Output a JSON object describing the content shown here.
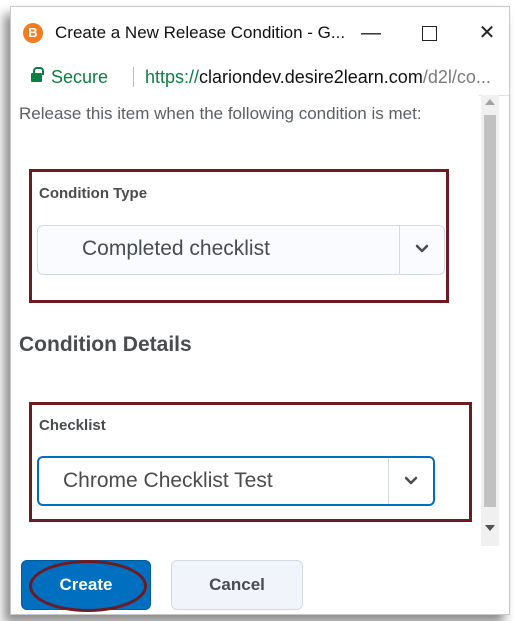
{
  "window": {
    "title": "Create a New Release Condition - G...",
    "favicon_glyph": "B",
    "controls": {
      "minimize": "—",
      "close": "✕"
    }
  },
  "addressbar": {
    "secure_label": "Secure",
    "url_scheme": "https://",
    "url_host": "clariondev.desire2learn.com",
    "url_path": "/d2l/co..."
  },
  "dialog": {
    "intro": "Release this item when the following condition is met:",
    "condition_type": {
      "label": "Condition Type",
      "selected": "Completed checklist"
    },
    "details_heading": "Condition Details",
    "checklist": {
      "label": "Checklist",
      "selected": "Chrome Checklist Test"
    },
    "buttons": {
      "create": "Create",
      "cancel": "Cancel"
    }
  },
  "colors": {
    "highlight": "#6f1920",
    "primary": "#006fbf",
    "secure_green": "#0b8043"
  }
}
